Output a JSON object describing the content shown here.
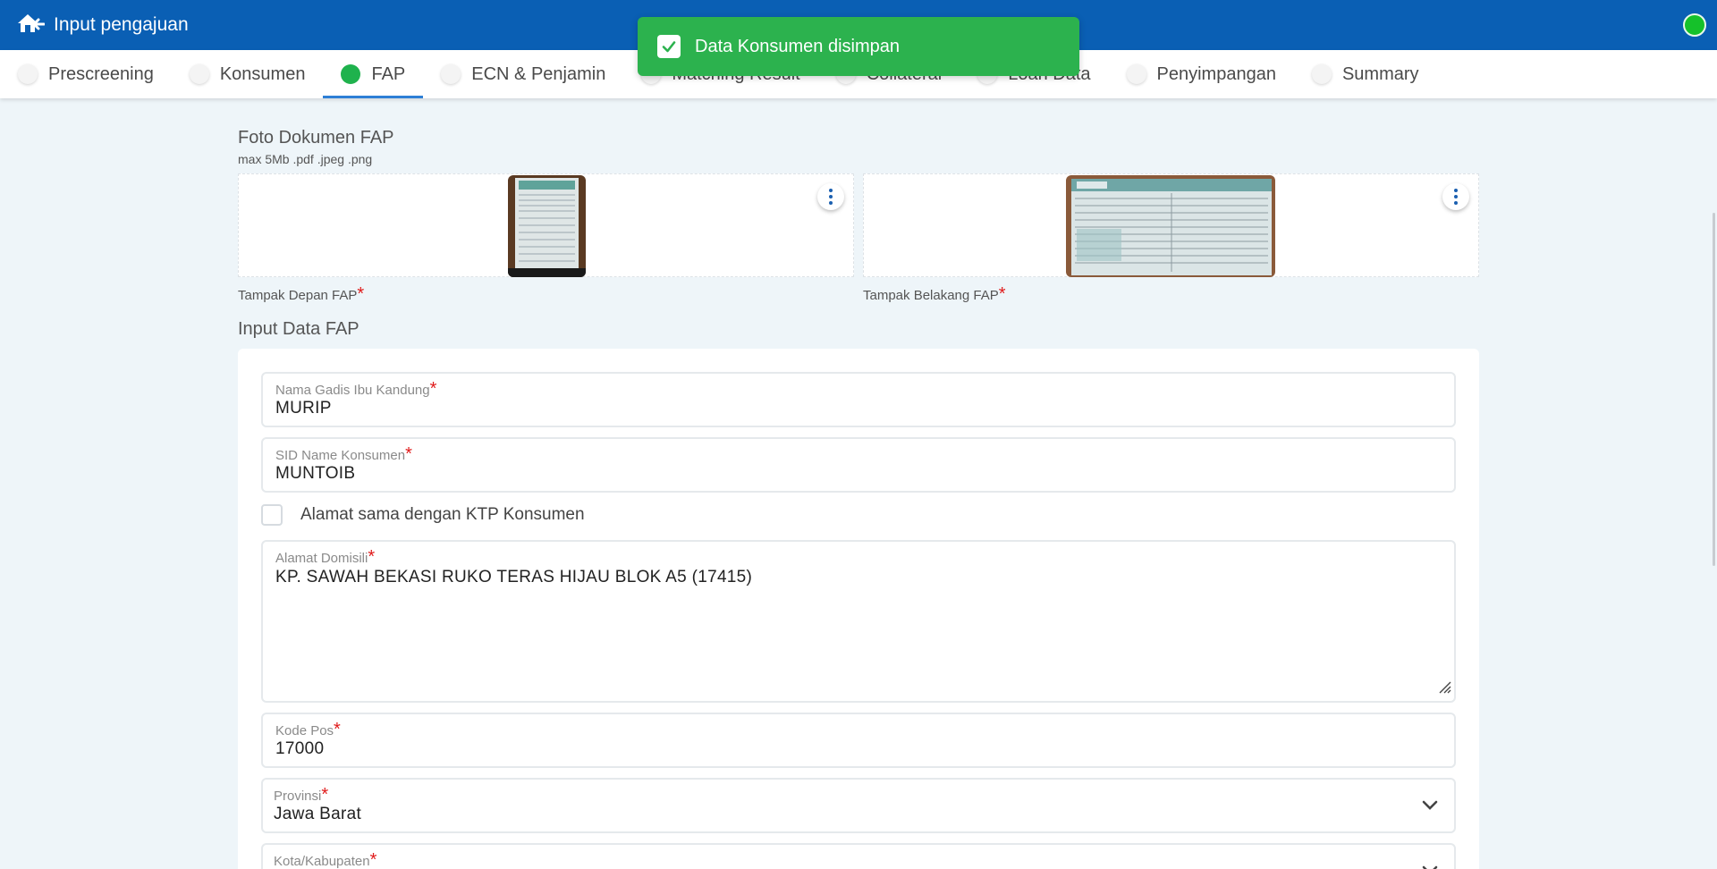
{
  "header": {
    "title": "Input pengajuan"
  },
  "toast": {
    "message": "Data Konsumen disimpan"
  },
  "tabs": [
    {
      "label": "Prescreening",
      "active": false
    },
    {
      "label": "Konsumen",
      "active": false
    },
    {
      "label": "FAP",
      "active": true
    },
    {
      "label": "ECN & Penjamin",
      "active": false
    },
    {
      "label": "Matching Result",
      "active": false
    },
    {
      "label": "Collateral",
      "active": false
    },
    {
      "label": "Loan Data",
      "active": false
    },
    {
      "label": "Penyimpangan",
      "active": false
    },
    {
      "label": "Summary",
      "active": false
    }
  ],
  "documents": {
    "title": "Foto Dokumen FAP",
    "hint": "max 5Mb .pdf .jpeg .png",
    "front_label": "Tampak Depan FAP",
    "back_label": "Tampak Belakang FAP",
    "required_mark": "*"
  },
  "form": {
    "title": "Input Data FAP",
    "required_mark": "*",
    "mother_name": {
      "label": "Nama Gadis Ibu Kandung",
      "value": "MURIP"
    },
    "sid_name": {
      "label": "SID Name Konsumen",
      "value": "MUNTOIB"
    },
    "same_address": {
      "label": "Alamat sama dengan KTP Konsumen",
      "checked": false
    },
    "address": {
      "label": "Alamat Domisili",
      "value": "KP. SAWAH BEKASI RUKO TERAS HIJAU BLOK A5 (17415)"
    },
    "postal_code": {
      "label": "Kode Pos",
      "value": "17000"
    },
    "province": {
      "label": "Provinsi",
      "value": "Jawa Barat"
    },
    "city": {
      "label": "Kota/Kabupaten",
      "value": ""
    }
  },
  "colors": {
    "header": "#0a5fb4",
    "toast": "#2cb24e",
    "active_step": "#1fb24d",
    "required": "#e01b1b"
  }
}
